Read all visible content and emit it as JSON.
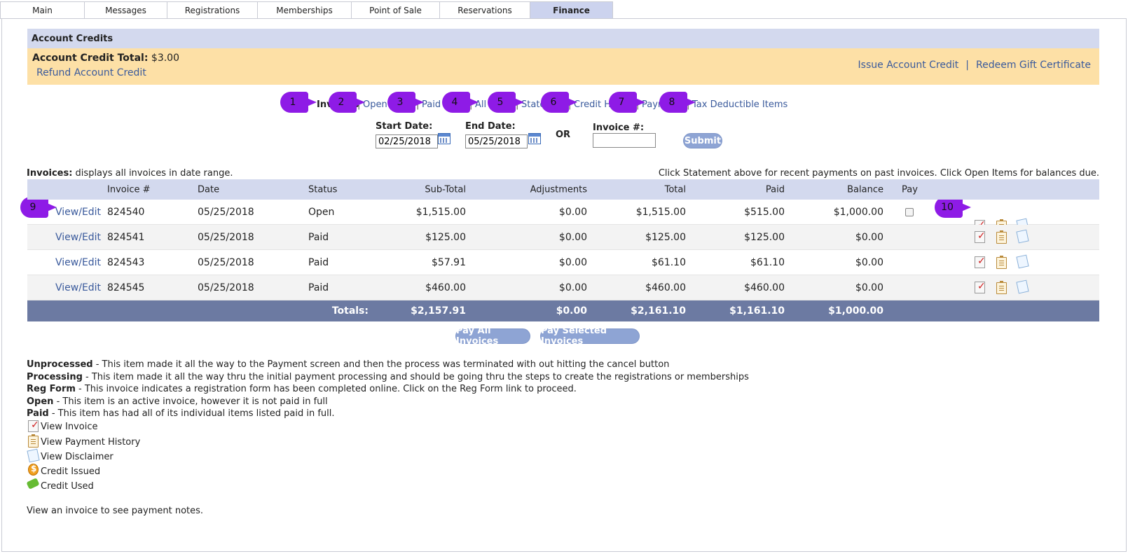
{
  "tabs": [
    {
      "label": "Main"
    },
    {
      "label": "Messages"
    },
    {
      "label": "Registrations"
    },
    {
      "label": "Memberships"
    },
    {
      "label": "Point of Sale"
    },
    {
      "label": "Reservations"
    },
    {
      "label": "Finance",
      "active": true
    }
  ],
  "account_credits": {
    "heading": "Account Credits",
    "total_label": "Account Credit Total:",
    "total_value": "$3.00",
    "refund_link": "Refund Account Credit",
    "issue_link": "Issue Account Credit",
    "separator": "|",
    "redeem_link": "Redeem Gift Certificate"
  },
  "subnav": {
    "items": [
      "Invoices",
      "Open Items",
      "Paid",
      "All",
      "Statement",
      "Credit History",
      "Payments",
      "Tax Deductible Items"
    ],
    "separator": "|"
  },
  "markers": [
    "1",
    "2",
    "3",
    "4",
    "5",
    "6",
    "7",
    "8",
    "9",
    "10"
  ],
  "filter": {
    "start_label": "Start Date:",
    "start_value": "02/25/2018",
    "end_label": "End Date:",
    "end_value": "05/25/2018",
    "or_label": "OR",
    "invoice_label": "Invoice #:",
    "invoice_value": "",
    "submit_label": "Submit"
  },
  "invoices": {
    "caption_bold": "Invoices:",
    "caption_text": " displays all invoices in date range.",
    "right_note": "Click Statement above for recent payments on past invoices. Click Open Items for balances due.",
    "columns": [
      "Invoice #",
      "Date",
      "Status",
      "Sub-Total",
      "Adjustments",
      "Total",
      "Paid",
      "Balance",
      "Pay"
    ],
    "rows": [
      {
        "action": "View/Edit",
        "invoice": "824540",
        "date": "05/25/2018",
        "status": "Open",
        "subtotal": "$1,515.00",
        "adjustments": "$0.00",
        "total": "$1,515.00",
        "paid": "$515.00",
        "balance": "$1,000.00",
        "payable": true
      },
      {
        "action": "View/Edit",
        "invoice": "824541",
        "date": "05/25/2018",
        "status": "Paid",
        "subtotal": "$125.00",
        "adjustments": "$0.00",
        "total": "$125.00",
        "paid": "$125.00",
        "balance": "$0.00",
        "payable": false
      },
      {
        "action": "View/Edit",
        "invoice": "824543",
        "date": "05/25/2018",
        "status": "Paid",
        "subtotal": "$57.91",
        "adjustments": "$0.00",
        "total": "$61.10",
        "paid": "$61.10",
        "balance": "$0.00",
        "payable": false
      },
      {
        "action": "View/Edit",
        "invoice": "824545",
        "date": "05/25/2018",
        "status": "Paid",
        "subtotal": "$460.00",
        "adjustments": "$0.00",
        "total": "$460.00",
        "paid": "$460.00",
        "balance": "$0.00",
        "payable": false
      }
    ],
    "totals": {
      "label": "Totals:",
      "subtotal": "$2,157.91",
      "adjustments": "$0.00",
      "total": "$2,161.10",
      "paid": "$1,161.10",
      "balance": "$1,000.00"
    },
    "pay_all_label": "Pay All Invoices",
    "pay_selected_label": "Pay Selected Invoices"
  },
  "legend": {
    "statuses": [
      {
        "term": "Unprocessed",
        "desc": " - This item made it all the way to the Payment screen and then the process was terminated with out hitting the cancel button"
      },
      {
        "term": "Processing",
        "desc": " - This item made it all the way thru the initial payment processing and should be going thru the steps to create the registrations or memberships"
      },
      {
        "term": "Reg Form",
        "desc": " - This invoice indicates a registration form has been completed online. Click on the Reg Form link to proceed."
      },
      {
        "term": "Open",
        "desc": " - This item is an active invoice, however it is not paid in full"
      },
      {
        "term": "Paid",
        "desc": " - This item has had all of its individual items listed paid in full."
      }
    ],
    "icons": [
      {
        "icon": "view-invoice-icon",
        "label": "View Invoice"
      },
      {
        "icon": "payment-history-icon",
        "label": "View Payment History"
      },
      {
        "icon": "disclaimer-icon",
        "label": "View Disclaimer"
      },
      {
        "icon": "credit-issued-icon",
        "label": "Credit Issued"
      },
      {
        "icon": "credit-used-icon",
        "label": "Credit Used"
      }
    ],
    "footnote": "View an invoice to see payment notes."
  },
  "colors": {
    "header_bg": "#d3d9ee",
    "credit_bg": "#fde0a6",
    "link": "#3a5a9c",
    "marker": "#8e1be6",
    "totals_bg": "#6c7aa2",
    "button": "#8ea4d4"
  }
}
